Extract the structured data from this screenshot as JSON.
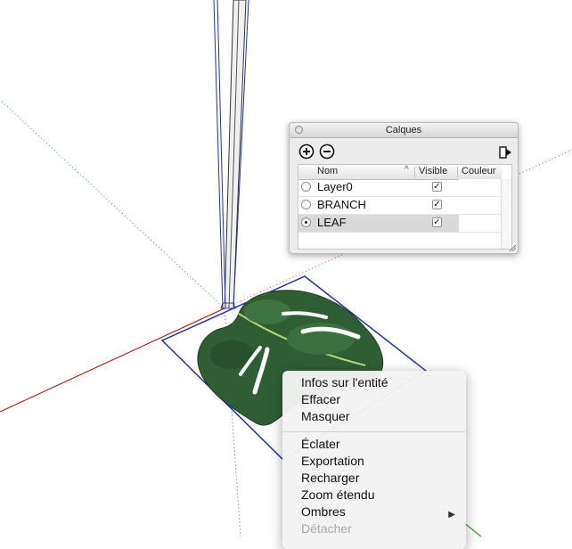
{
  "layers_panel": {
    "title": "Calques",
    "columns": {
      "name": "Nom",
      "visible": "Visible",
      "color": "Couleur"
    },
    "rows": [
      {
        "name": "Layer0",
        "active": false,
        "visible": true
      },
      {
        "name": "BRANCH",
        "active": false,
        "visible": true
      },
      {
        "name": "LEAF",
        "active": true,
        "visible": true
      }
    ],
    "check_glyph": "✓",
    "sort_glyph": "^"
  },
  "context_menu": {
    "items": [
      {
        "label": "Infos sur l'entité"
      },
      {
        "label": "Effacer"
      },
      {
        "label": "Masquer"
      },
      {
        "label": "Éclater"
      },
      {
        "label": "Exportation"
      },
      {
        "label": "Recharger"
      },
      {
        "label": "Zoom étendu"
      },
      {
        "label": "Ombres"
      },
      {
        "label": "Détacher"
      }
    ],
    "submenu_arrow": "▶"
  }
}
